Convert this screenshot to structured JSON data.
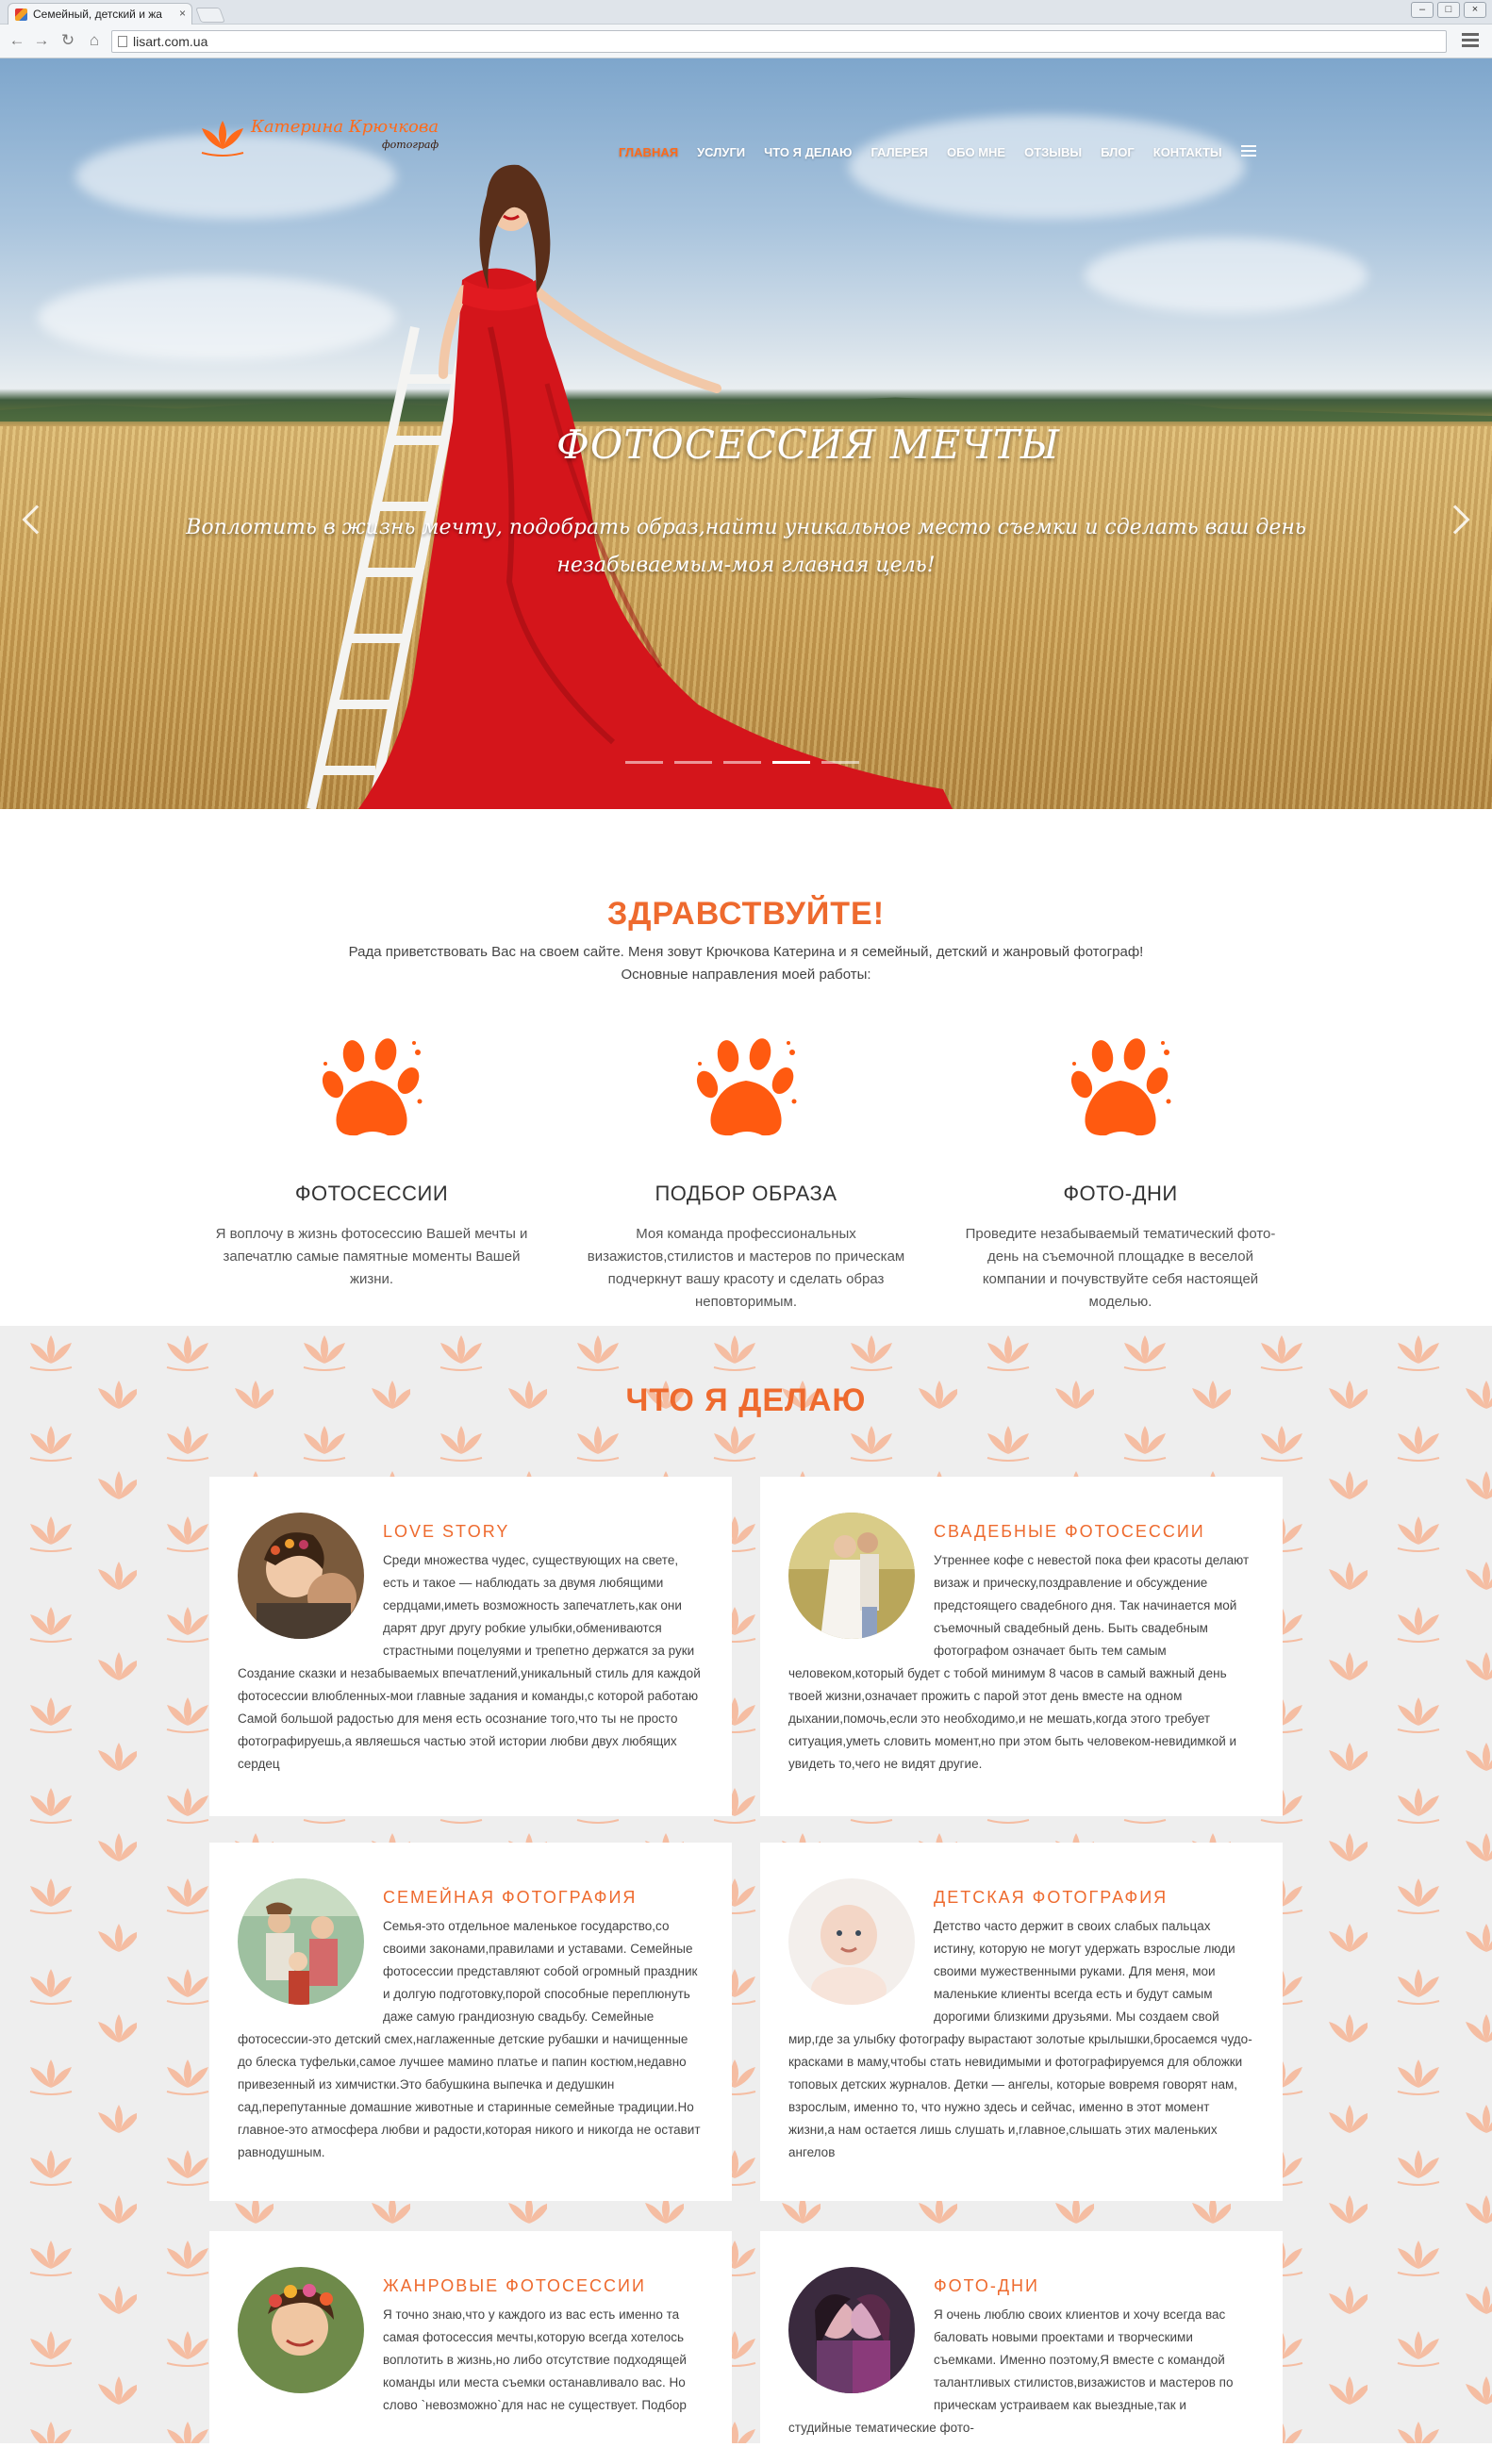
{
  "browser": {
    "tab_title": "Семейный, детский и жа",
    "tab_close": "×",
    "url": "lisart.com.ua",
    "back": "←",
    "forward": "→",
    "reload": "↻",
    "home": "⌂",
    "win_min": "–",
    "win_max": "□",
    "win_close": "×"
  },
  "brand": {
    "name": "Катерина Крючкова",
    "subtitle": "фотограф",
    "accent": "#ee6a2e"
  },
  "nav": {
    "items": [
      "Главная",
      "Услуги",
      "Что я делаю",
      "Галерея",
      "Обо мне",
      "Отзывы",
      "Блог",
      "Контакты"
    ],
    "active_index": 0
  },
  "hero": {
    "title": "ФОТОСЕССИЯ МЕЧТЫ",
    "subtitle": "Воплотить в жизнь мечту, подобрать образ,найти уникальное место съемки и сделать ваш день незабываемым-моя главная цель!",
    "slide_count": 5,
    "active_slide": 4
  },
  "greeting": {
    "title": "ЗДРАВСТВУЙТЕ!",
    "line1": "Рада приветствовать Вас на своем сайте. Меня зовут Крючкова Катерина и я семейный, детский и жанровый фотограф!",
    "line2": "Основные направления моей работы:"
  },
  "features": [
    {
      "title": "ФОТОСЕССИИ",
      "text": "Я воплочу в жизнь фотосессию Вашей мечты и запечатлю самые памятные моменты Вашей жизни."
    },
    {
      "title": "ПОДБОР ОБРАЗА",
      "text": "Моя команда профессиональных визажистов,стилистов и мастеров по прическам подчеркнут вашу красоту и сделать образ неповторимым."
    },
    {
      "title": "ФОТО-ДНИ",
      "text": "Проведите незабываемый тематический фото-день на съемочной площадке в веселой компании и почувствуйте себя настоящей моделью."
    }
  ],
  "what": {
    "title": "ЧТО Я ДЕЛАЮ",
    "cards": [
      {
        "title": "LOVE STORY",
        "text": "Среди множества чудес, существующих на свете, есть и такое — наблюдать за двумя любящими сердцами,иметь возможность запечатлеть,как они дарят друг другу робкие улыбки,обмениваются страстными поцелуями и трепетно держатся за руки Создание сказки и незабываемых впечатлений,уникальный стиль для каждой фотосессии влюбленных-мои главные задания и команды,с которой работаю Самой большой радостью для меня есть осознание того,что ты не просто фотографируешь,а являешься частью этой истории любви двух любящих сердец"
      },
      {
        "title": "СВАДЕБНЫЕ ФОТОСЕССИИ",
        "text": "Утреннее кофе с невестой пока феи красоты делают визаж и прическу,поздравление и обсуждение предстоящего свадебного дня.   Так начинается мой съемочный свадебный день. Быть свадебным фотографом означает быть тем самым человеком,который будет с тобой минимум 8 часов в самый важный день твоей жизни,означает прожить с парой этот день вместе на одном дыхании,помочь,если это необходимо,и не мешать,когда этого требует ситуация,уметь словить момент,но при этом быть человеком-невидимкой и увидеть то,чего не видят другие."
      },
      {
        "title": "СЕМЕЙНАЯ ФОТОГРАФИЯ",
        "text": "Семья-это отдельное маленькое государство,со своими законами,правилами и уставами. Семейные фотосессии представляют собой огромный праздник и долгую подготовку,порой способные переплюнуть даже самую грандиозную свадьбу. Семейные фотосессии-это детский смех,наглаженные детские рубашки и начищенные до блеска туфельки,самое лучшее мамино платье и папин костюм,недавно привезенный из химчистки.Это бабушкина выпечка и дедушкин сад,перепутанные домашние животные и старинные семейные традиции.Но главное-это атмосфера любви и радости,которая никого и никогда не оставит равнодушным."
      },
      {
        "title": "ДЕТСКАЯ ФОТОГРАФИЯ",
        "text": "Детство часто держит в своих слабых пальцах истину, которую не могут удержать взрослые люди своими мужественными руками. Для меня, мои маленькие клиенты всегда есть и будут самым дорогими близкими друзьями. Мы создаем свой мир,где за улыбку фотографу вырастают золотые крылышки,бросаемся чудо-красками в маму,чтобы стать невидимыми и фотографируемся для обложки топовых детских журналов. Детки — ангелы, которые вовремя говорят нам, взрослым, именно то, что нужно здесь и сейчас, именно в этот момент жизни,а нам остается лишь слушать и,главное,слышать этих маленьких ангелов"
      },
      {
        "title": "ЖАНРОВЫЕ ФОТОСЕССИИ",
        "text": "Я точно знаю,что у каждого из вас есть именно та самая фотосессия мечты,которую всегда хотелось воплотить в жизнь,но либо отсутствие подходящей команды или места съемки останавливало вас. Но слово `невозможно`для нас не существует. Подбор"
      },
      {
        "title": "ФОТО-ДНИ",
        "text": "Я очень люблю своих клиентов и хочу всегда вас баловать новыми проектами и творческими съемками. Именно поэтому,Я вместе с командой талантливых стилистов,визажистов и мастеров по прическам устраиваем как выездные,так и студийные тематические фото-"
      }
    ]
  }
}
